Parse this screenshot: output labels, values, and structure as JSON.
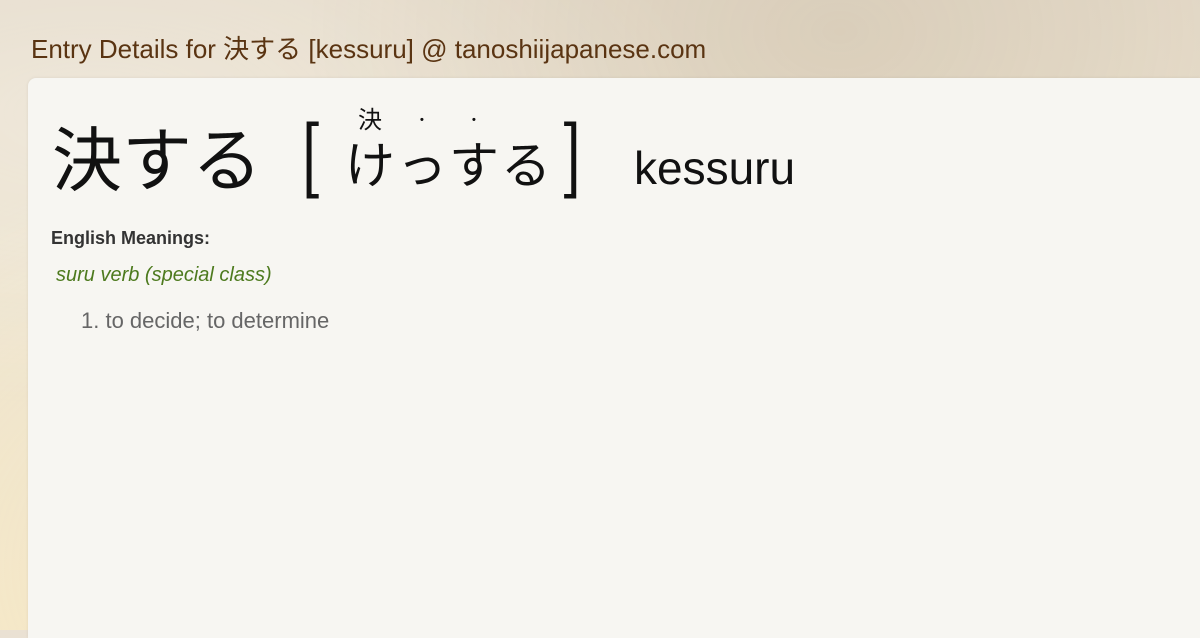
{
  "header": {
    "title": "Entry Details for 決する [kessuru] @ tanoshiijapanese.com"
  },
  "entry": {
    "word": "決する",
    "bracket_open": "[",
    "bracket_close": "]",
    "reading": [
      {
        "furigana": "決",
        "kana": "け"
      },
      {
        "furigana": "·",
        "kana": "っ"
      },
      {
        "furigana": "·",
        "kana": "す"
      },
      {
        "furigana": "",
        "kana": "る"
      }
    ],
    "romaji": "kessuru"
  },
  "meanings": {
    "label": "English Meanings:",
    "part_of_speech": "suru verb (special class)",
    "definition": "1. to decide; to determine"
  }
}
